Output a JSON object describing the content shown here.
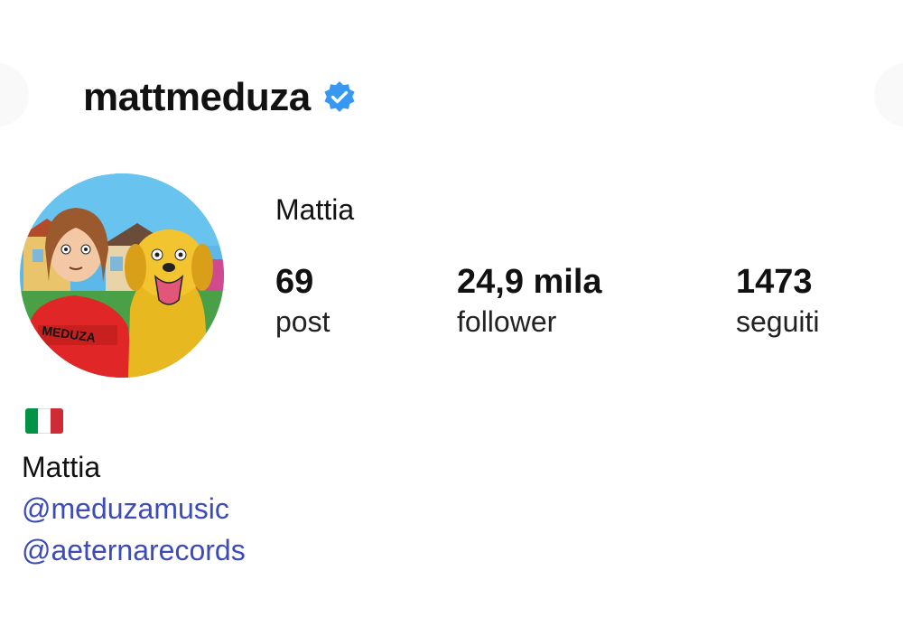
{
  "profile": {
    "username": "mattmeduza",
    "display_name": "Mattia",
    "verified_icon": "verified-badge-icon",
    "avatar_icon": "cartoon-avatar-boy-and-dog",
    "stats": [
      {
        "value": "69",
        "label": "post"
      },
      {
        "value": "24,9 mila",
        "label": "follower"
      },
      {
        "value": "1473",
        "label": "seguiti"
      }
    ],
    "bio": {
      "flag_icon": "italian-flag-icon",
      "name": "Mattia",
      "links": [
        "@meduzamusic",
        "@aeternarecords"
      ]
    }
  },
  "colors": {
    "verified_blue": "#3897f0",
    "link_blue": "#3d4bb8",
    "text": "#111111",
    "flag_green": "#009246",
    "flag_white": "#ffffff",
    "flag_red": "#ce2b37"
  }
}
